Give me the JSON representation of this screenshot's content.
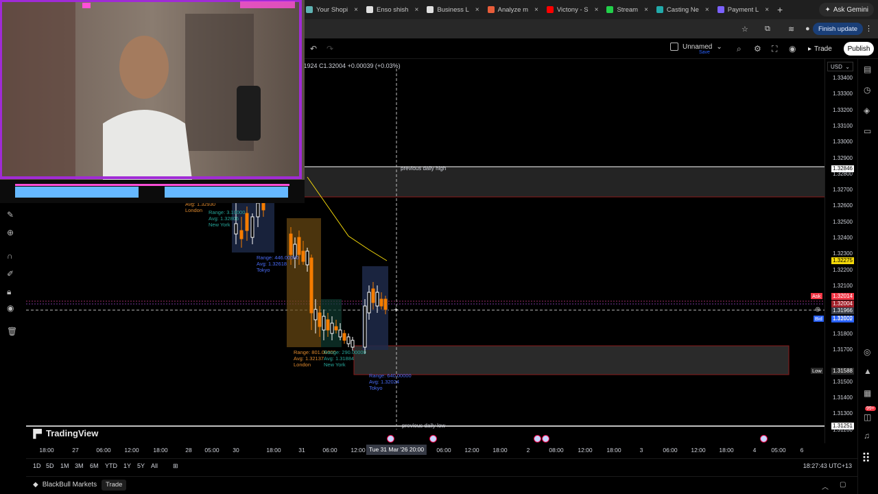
{
  "browser": {
    "tabs": [
      {
        "label": "Your Shopi",
        "color": "#5fb3b3"
      },
      {
        "label": "Enso shish",
        "color": "#e0e0e0"
      },
      {
        "label": "Business L",
        "color": "#e0e0e0"
      },
      {
        "label": "Analyze m",
        "color": "#e85d3a"
      },
      {
        "label": "Victony - S",
        "color": "#ff0000"
      },
      {
        "label": "Stream",
        "color": "#22d04a"
      },
      {
        "label": "Casting Ne",
        "color": "#2aa"
      },
      {
        "label": "Payment L",
        "color": "#7b61ff"
      }
    ],
    "ask_gemini": "Ask Gemini",
    "finish_update": "Finish update"
  },
  "toolbar": {
    "layout_name": "Unnamed",
    "layout_sub": "Save",
    "trade": "Trade",
    "publish": "Publish"
  },
  "chart": {
    "ohlc": "1.31924 C1.32004 +0.00039 (+0.03%)",
    "currency": "USD",
    "price_ticks": [
      "1.33400",
      "1.33300",
      "1.33200",
      "1.33100",
      "1.33000",
      "1.32900",
      "1.32800",
      "1.32700",
      "1.32600",
      "1.32500",
      "1.32400",
      "1.32300",
      "1.32200",
      "1.32100",
      "1.31900",
      "1.31800",
      "1.31700",
      "1.31500",
      "1.31400",
      "1.31300",
      "1.31200"
    ],
    "labels": {
      "prev_high": "previous daily high",
      "prev_low": "previous daily low",
      "prev_high_price": "1.32846",
      "prev_low_price": "1.31251",
      "yellow_price": "1.32275",
      "ask_label": "Ask",
      "ask_price": "1.32014",
      "mid_red_price": "1.32004",
      "cross_price": "1.31966",
      "bid_label": "Bid",
      "bid_price": "1.32002",
      "low_label": "Low",
      "low_price": "1.31588"
    },
    "sessions": [
      {
        "range": "Range:",
        "avg": "Avg: 1.32930",
        "name": "London",
        "color": "#e08a2e"
      },
      {
        "range": "Range: 3.10000",
        "avg": "Avg: 1.32806",
        "name": "New York",
        "color": "#26a69a"
      },
      {
        "range": "Range: 446.00000",
        "avg": "Avg: 1.32618",
        "name": "Tokyo",
        "color": "#4a6cf7"
      },
      {
        "range": "Range: 801.00000",
        "avg": "Avg: 1.32137",
        "name": "London",
        "color": "#e08a2e"
      },
      {
        "range": "Range: 290.00000",
        "avg": "Avg: 1.31884",
        "name": "New York",
        "color": "#26a69a"
      },
      {
        "range": "Range: 640.00000",
        "avg": "Avg: 1.32024",
        "name": "Tokyo",
        "color": "#4a6cf7"
      }
    ]
  },
  "time_axis": {
    "ticks": [
      "18:00",
      "27",
      "06:00",
      "12:00",
      "18:00",
      "28",
      "05:00",
      "30",
      "18:00",
      "31",
      "06:00",
      "12:00",
      "06:00",
      "12:00",
      "18:00",
      "2",
      "08:00",
      "12:00",
      "18:00",
      "3",
      "06:00",
      "12:00",
      "18:00",
      "4",
      "05:00",
      "6"
    ],
    "crosshair": "Tue 31 Mar '26   20:00"
  },
  "range_buttons": [
    "1D",
    "5D",
    "1M",
    "3M",
    "6M",
    "YTD",
    "1Y",
    "5Y",
    "All"
  ],
  "clock": "18:27:43 UTC+13",
  "brand": "TradingView",
  "broker": {
    "name": "BlackBull Markets",
    "trade": "Trade"
  },
  "notifications": "99+",
  "colors": {
    "bull": "#ffffff",
    "bear": "#f57c00",
    "accent": "#2962ff",
    "ask": "#f23645",
    "bid": "#2962ff",
    "yellow": "#f5d90a"
  }
}
